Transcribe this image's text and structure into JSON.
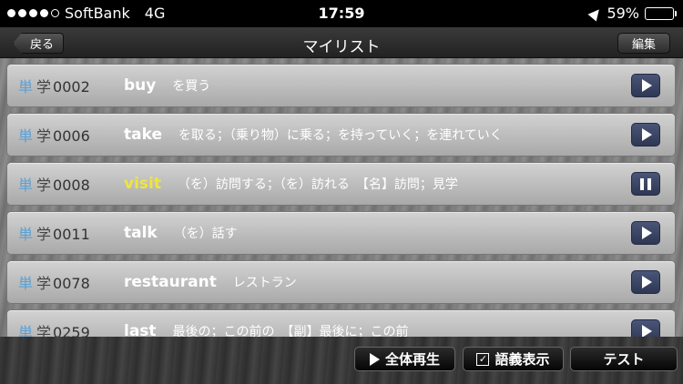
{
  "status": {
    "carrier": "SoftBank",
    "network": "4G",
    "time": "17:59",
    "battery": "59%",
    "battery_level": 0.59
  },
  "nav": {
    "back_label": "戻る",
    "title": "マイリスト",
    "edit_label": "編集"
  },
  "items": [
    {
      "k1": "単",
      "k2": "学",
      "num": "0002",
      "word": "buy",
      "meaning": "を買う",
      "state": "play"
    },
    {
      "k1": "単",
      "k2": "学",
      "num": "0006",
      "word": "take",
      "meaning": "を取る；（乗り物）に乗る；を持っていく；を連れていく",
      "state": "play"
    },
    {
      "k1": "単",
      "k2": "学",
      "num": "0008",
      "word": "visit",
      "meaning": "（を）訪問する；（を）訪れる　【名】訪問；見学",
      "state": "pause"
    },
    {
      "k1": "単",
      "k2": "学",
      "num": "0011",
      "word": "talk",
      "meaning": "（を）話す",
      "state": "play"
    },
    {
      "k1": "単",
      "k2": "学",
      "num": "0078",
      "word": "restaurant",
      "meaning": "レストラン",
      "state": "play"
    },
    {
      "k1": "単",
      "k2": "学",
      "num": "0259",
      "word": "last",
      "meaning": "最後の；この前の　【副】最後に；この前",
      "state": "play"
    }
  ],
  "toolbar": {
    "play_all_label": "全体再生",
    "show_meaning_label": "語義表示",
    "show_meaning_checked": true,
    "test_label": "テスト"
  },
  "colors": {
    "active_word": "#f0e63a",
    "kanji_accent": "#5aa0d6",
    "play_button": "#3b4566"
  }
}
